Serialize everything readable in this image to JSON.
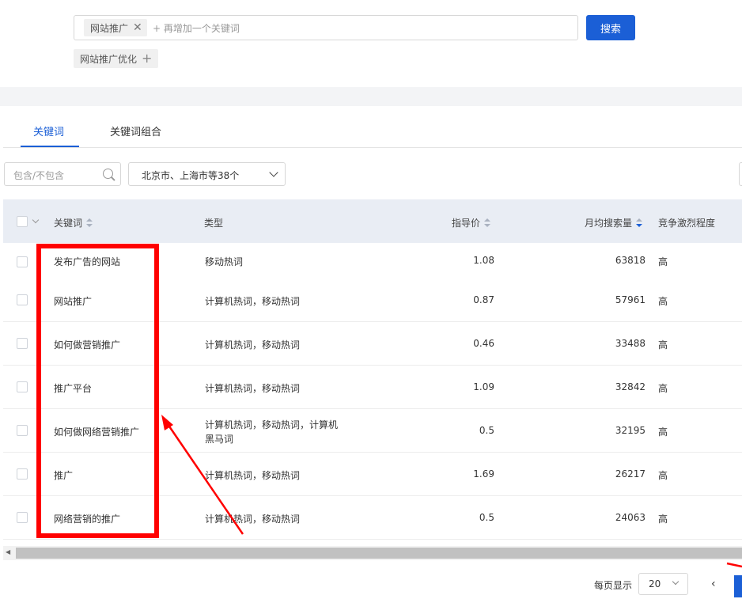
{
  "search": {
    "tag": "网站推广",
    "add_more": "+ 再增加一个关键词",
    "button": "搜索",
    "suggestion": "网站推广优化"
  },
  "tabs": [
    "关键词",
    "关键词组合"
  ],
  "filters": {
    "include_placeholder": "包含/不包含",
    "region": "北京市、上海市等38个"
  },
  "table": {
    "headers": {
      "keyword": "关键词",
      "type": "类型",
      "price": "指导价",
      "monthly": "月均搜索量",
      "competition": "竞争激烈程度"
    },
    "rows": [
      {
        "keyword": "发布广告的网站",
        "type": "移动热词",
        "type2": "",
        "price": "1.08",
        "monthly": "63818",
        "competition": "高"
      },
      {
        "keyword": "网站推广",
        "type": "计算机热词，移动热词",
        "type2": "",
        "price": "0.87",
        "monthly": "57961",
        "competition": "高"
      },
      {
        "keyword": "如何做营销推广",
        "type": "计算机热词，移动热词",
        "type2": "",
        "price": "0.46",
        "monthly": "33488",
        "competition": "高"
      },
      {
        "keyword": "推广平台",
        "type": "计算机热词，移动热词",
        "type2": "",
        "price": "1.09",
        "monthly": "32842",
        "competition": "高"
      },
      {
        "keyword": "如何做网络营销推广",
        "type": "计算机热词，移动热词，计算机",
        "type2": "黑马词",
        "price": "0.5",
        "monthly": "32195",
        "competition": "高"
      },
      {
        "keyword": "推广",
        "type": "计算机热词，移动热词",
        "type2": "",
        "price": "1.69",
        "monthly": "26217",
        "competition": "高"
      },
      {
        "keyword": "网络营销的推广",
        "type": "计算机热词，移动热词",
        "type2": "",
        "price": "0.5",
        "monthly": "24063",
        "competition": "高"
      }
    ]
  },
  "pagination": {
    "per_page_label": "每页显示",
    "per_page": "20",
    "prev": "‹"
  },
  "colors": {
    "primary": "#1b5fd6",
    "annotation": "#ff0000"
  }
}
